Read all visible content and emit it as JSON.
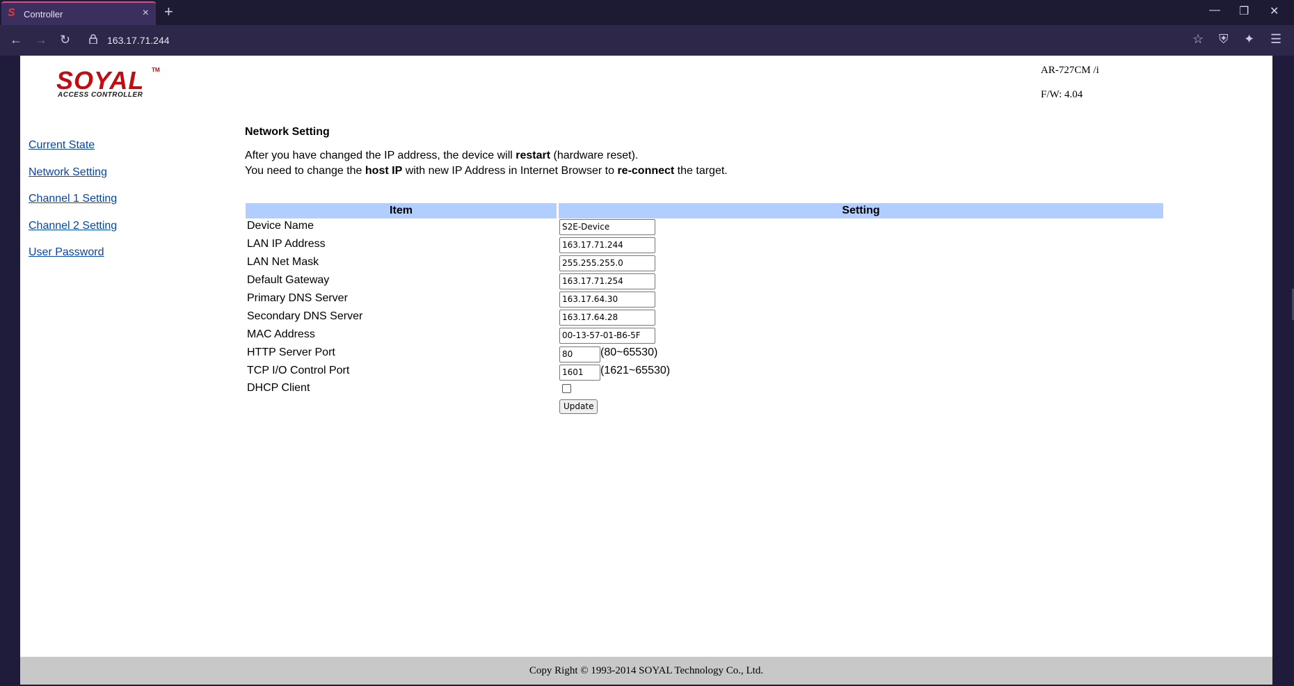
{
  "browser": {
    "tab_title": "Controller",
    "tab_close": "×",
    "new_tab": "+",
    "url": "163.17.71.244"
  },
  "header": {
    "logo_main": "SOYAL",
    "logo_tm": "TM",
    "logo_sub": "ACCESS CONTROLLER",
    "model": "AR-727CM /i",
    "firmware": "F/W: 4.04"
  },
  "sidebar": {
    "items": [
      {
        "label": "Current State"
      },
      {
        "label": "Network Setting"
      },
      {
        "label": "Channel 1 Setting"
      },
      {
        "label": "Channel 2 Setting"
      },
      {
        "label": "User Password"
      }
    ]
  },
  "main": {
    "title": "Network Setting",
    "note1": {
      "pre": "After you have changed the IP address, the device will ",
      "b1": "restart",
      "post": " (hardware reset)."
    },
    "note2": {
      "pre": "You need to change the ",
      "b1": "host IP",
      "mid": " with new IP Address in Internet Browser to ",
      "b2": "re-connect",
      "post": " the target."
    },
    "table": {
      "headers": [
        "Item",
        "Setting"
      ],
      "rows": [
        {
          "label": "Device Name",
          "value": "S2E-Device"
        },
        {
          "label": "LAN IP Address",
          "value": "163.17.71.244"
        },
        {
          "label": "LAN Net Mask",
          "value": "255.255.255.0"
        },
        {
          "label": "Default Gateway",
          "value": "163.17.71.254"
        },
        {
          "label": "Primary DNS Server",
          "value": "163.17.64.30"
        },
        {
          "label": "Secondary DNS Server",
          "value": "163.17.64.28"
        },
        {
          "label": "MAC Address",
          "value": "00-13-57-01-B6-5F"
        },
        {
          "label": "HTTP Server Port",
          "value": "80",
          "range": "(80~65530)"
        },
        {
          "label": "TCP I/O Control Port",
          "value": "1601",
          "range": "(1621~65530)"
        },
        {
          "label": "DHCP Client",
          "checked": false
        }
      ]
    },
    "update_label": "Update"
  },
  "footer": {
    "text": "Copy Right © 1993-2014 SOYAL Technology Co., Ltd."
  },
  "colors": {
    "table_header": "#b2cdff",
    "link": "#0645ad",
    "logo_red": "#c00d12",
    "footer_bg": "#c8c8c8"
  }
}
